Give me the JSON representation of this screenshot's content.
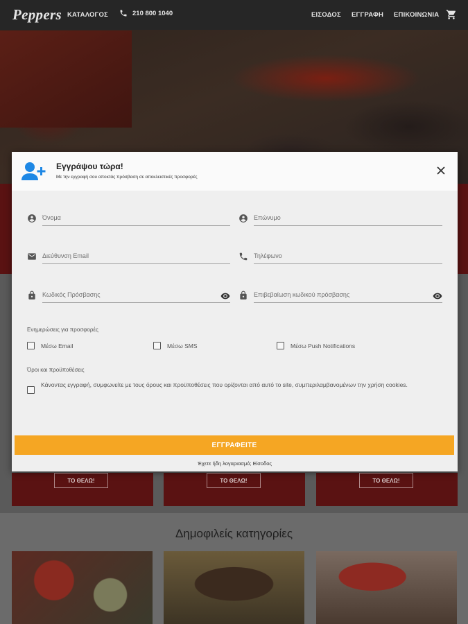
{
  "header": {
    "logo": "Peppers",
    "catalog": "ΚΑΤΑΛΟΓΟΣ",
    "phone": "210 800 1040",
    "login": "ΕΙΣΟΔΟΣ",
    "register": "ΕΓΓΡΑΦΗ",
    "contact": "ΕΠΙΚΟΙΝΩΝΙΑ"
  },
  "page": {
    "card_button": "ΤΟ ΘΕΛΩ!",
    "popular_title": "Δημοφιλείς κατηγορίες"
  },
  "modal": {
    "title": "Εγγράψου τώρα!",
    "subtitle": "Με την εγγραφή σου αποκτάς πρόσβαση σε αποκλειστικές προσφορές",
    "fields": {
      "first_name": "Όνομα",
      "last_name": "Επώνυμο",
      "email": "Διεύθυνση Email",
      "phone": "Τηλέφωνο",
      "password": "Κωδικός Πρόσβασης",
      "password_confirm": "Επιβεβαίωση κωδικού πρόσβασης"
    },
    "notify_label": "Ενημερώσεις για προσφορές",
    "notify_options": [
      "Μέσω Email",
      "Μέσω SMS",
      "Μέσω Push Notifications"
    ],
    "terms_label": "Όροι και προϋποθέσεις",
    "terms_text": "Κάνοντας εγγραφή, συμφωνείτε με τους όρους και προϋποθέσεις που ορίζονται από αυτό το site, συμπεριλαμβανομένων την χρήση cookies.",
    "submit": "ΕΓΓΡΑΦΕΙΤΕ",
    "login_note": "Έχετε ήδη λογαριασμό; Είσοδος"
  },
  "colors": {
    "header_bg": "#262626",
    "accent": "#f5a623",
    "user_icon": "#1e88e5",
    "dark_red": "#5a1212"
  },
  "icons": [
    "phone-icon",
    "cart-icon",
    "user-add-icon",
    "close-icon",
    "person-icon",
    "email-icon",
    "phone-icon",
    "lock-icon",
    "eye-icon",
    "checkbox-icon"
  ]
}
